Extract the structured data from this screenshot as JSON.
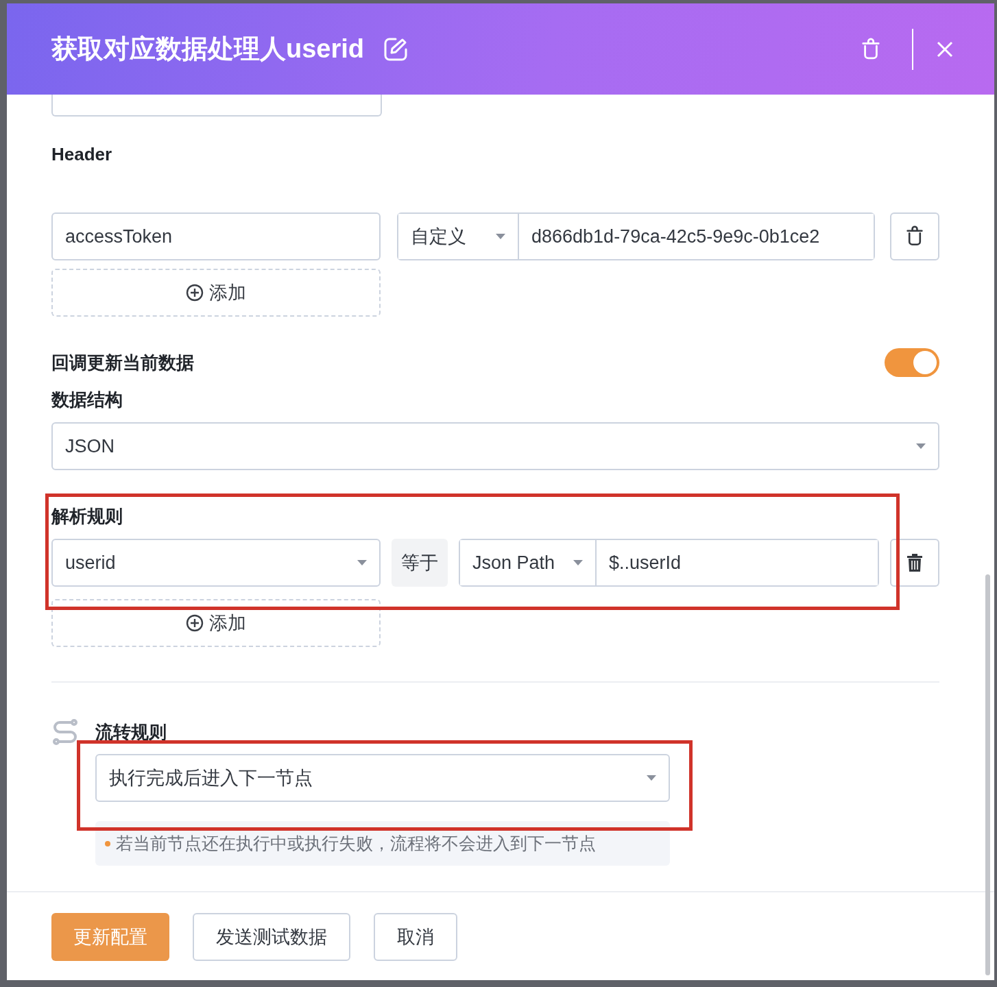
{
  "dialog": {
    "title": "获取对应数据处理人userid"
  },
  "header_section": {
    "label": "Header",
    "rows": [
      {
        "key": "accessToken",
        "type": "自定义",
        "value": "d866db1d-79ca-42c5-9e9c-0b1ce2"
      }
    ],
    "add_label": "添加"
  },
  "callback": {
    "label": "回调更新当前数据",
    "on": true
  },
  "data_structure": {
    "label": "数据结构",
    "value": "JSON"
  },
  "parse_rules": {
    "label": "解析规则",
    "annotated": true,
    "rows": [
      {
        "field": "userid",
        "operator": "等于",
        "method": "Json Path",
        "value": "$..userId"
      }
    ],
    "add_label": "添加"
  },
  "flow_rules": {
    "label": "流转规则",
    "annotated": true,
    "value": "执行完成后进入下一节点",
    "hint": "若当前节点还在执行中或执行失败，流程将不会进入到下一节点"
  },
  "buttons": [
    {
      "label": "更新配置",
      "kind": "primary"
    },
    {
      "label": "发送测试数据",
      "kind": "default"
    },
    {
      "label": "取消",
      "kind": "default"
    }
  ]
}
